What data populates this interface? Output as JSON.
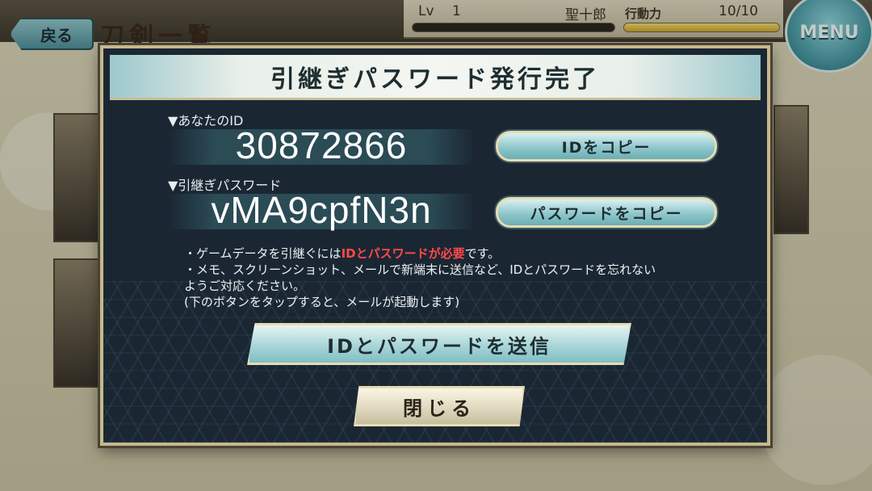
{
  "background": {
    "back_label": "戻る",
    "screen_title": "刀剣一覧",
    "status": {
      "lv_label": "Lv",
      "lv_value": "1",
      "player_name": "聖十郎",
      "stamina_label": "行動力",
      "stamina_value": "10/10",
      "stamina_fraction": 1.0
    },
    "menu_label": "MENU"
  },
  "dialog": {
    "title": "引継ぎパスワード発行完了",
    "id_label": "▼あなたのID",
    "id_value": "30872866",
    "copy_id_label": "IDをコピー",
    "password_label": "▼引継ぎパスワード",
    "password_value": "vMA9cpfN3n",
    "copy_password_label": "パスワードをコピー",
    "notes": {
      "line1_prefix": "・ゲームデータを引継ぐには",
      "line1_highlight": "IDとパスワードが必要",
      "line1_suffix": "です。",
      "line2": "・メモ、スクリーンショット、メールで新端末に送信など、IDとパスワードを忘れない",
      "line3": "ようご対応ください。",
      "line4": "(下のボタンをタップすると、メールが起動します)"
    },
    "send_label": "IDとパスワードを送信",
    "close_label": "閉じる"
  },
  "colors": {
    "dialog_bg": "#1a2733",
    "accent_teal": "#8fc7cc",
    "highlight_red": "#ff4a4a",
    "frame_gold": "#c5b98d"
  }
}
